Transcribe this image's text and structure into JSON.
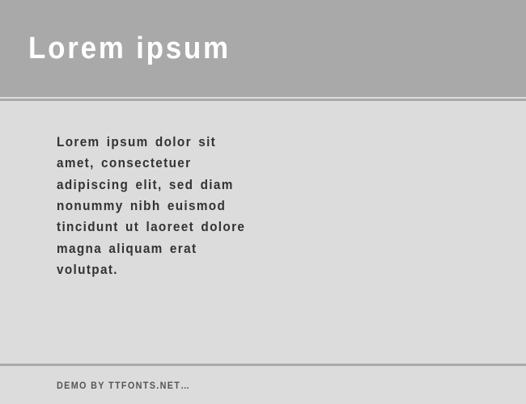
{
  "header": {
    "title": "Lorem ipsum"
  },
  "content": {
    "body_text": "Lorem ipsum dolor sit amet, consectetuer adipiscing elit, sed diam nonummy nibh euismod tincidunt ut laoreet dolore magna aliquam erat volutpat."
  },
  "footer": {
    "demo_text": "DEMO BY TTFONTS.NET…"
  }
}
